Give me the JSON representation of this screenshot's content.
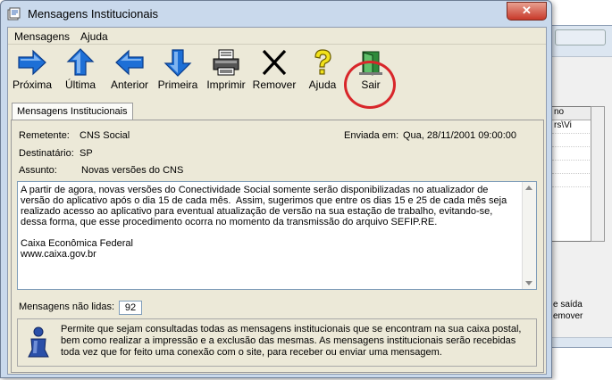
{
  "window": {
    "title": "Mensagens Institucionais",
    "close_symbol": "✕"
  },
  "menu": [
    {
      "label": "Mensagens"
    },
    {
      "label": "Ajuda"
    }
  ],
  "toolbar": {
    "next": "Próxima",
    "last": "Última",
    "previous": "Anterior",
    "first": "Primeira",
    "print": "Imprimir",
    "remove": "Remover",
    "help": "Ajuda",
    "exit": "Sair"
  },
  "tab": {
    "label": "Mensagens Institucionais"
  },
  "message": {
    "sender_label": "Remetente:",
    "sender": "CNS Social",
    "sent_label": "Enviada em:",
    "sent": "Qua, 28/11/2001 09:00:00",
    "recipient_label": "Destinatário:",
    "recipient": "SP",
    "subject_label": "Assunto:",
    "subject": "Novas versões do CNS",
    "body": "A partir de agora, novas versões do Conectividade Social somente serão disponibilizadas no atualizador de versão do aplicativo após o dia 15 de cada mês.  Assim, sugerimos que entre os dias 15 e 25 de cada mês seja realizado acesso ao aplicativo para eventual atualização de versão na sua estação de trabalho, evitando-se, dessa forma, que esse procedimento ocorra no momento da transmissão do arquivo SEFIP.RE.\n\nCaixa Econômica Federal\nwww.caixa.gov.br"
  },
  "unread": {
    "label": "Mensagens não lidas:",
    "count": "92"
  },
  "info": {
    "text": "Permite que sejam consultadas todas as mensagens institucionais que se encontram na sua caixa postal, bem como realizar a impressão e a exclusão das mesmas. As mensagens institucionais serão recebidas toda vez que for feito uma conexão com o site, para receber ou enviar uma mensagem."
  },
  "background_window": {
    "list_header": "no",
    "list_row": "rs\\Vi",
    "text_line1": "e saída",
    "text_line2": "emover"
  },
  "colors": {
    "highlight_circle": "#d8262a",
    "arrow_blue": "#1d6fd6",
    "help_yellow": "#f2e21a"
  },
  "icons": {
    "next": "arrow-right-icon",
    "last": "arrow-up-icon",
    "previous": "arrow-left-icon",
    "first": "arrow-down-icon",
    "print": "printer-icon",
    "remove": "x-icon",
    "help": "question-icon",
    "exit": "exit-door-icon",
    "info": "info-person-icon"
  }
}
